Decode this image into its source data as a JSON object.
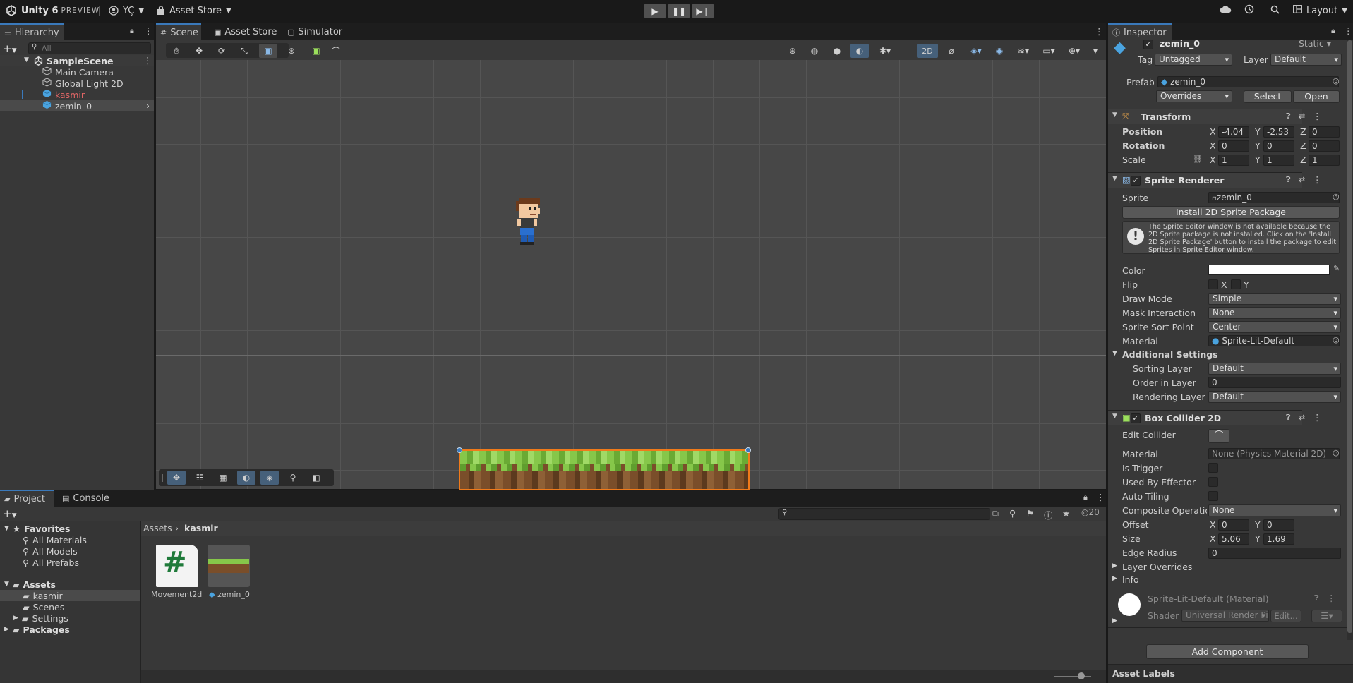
{
  "toolbar": {
    "app_title": "Unity 6",
    "app_edition": "PREVIEW",
    "account": "YÇ",
    "asset_store": "Asset Store",
    "layout": "Layout"
  },
  "hierarchy": {
    "tab": "Hierarchy",
    "search_placeholder": "All",
    "scene": "SampleScene",
    "items": [
      {
        "label": "Main Camera"
      },
      {
        "label": "Global Light 2D"
      },
      {
        "label": "kasmir"
      },
      {
        "label": "zemin_0"
      }
    ]
  },
  "scene_tabs": [
    {
      "label": "Scene"
    },
    {
      "label": "Asset Store"
    },
    {
      "label": "Simulator"
    }
  ],
  "scene_toolbar": {
    "mode_2d": "2D"
  },
  "project": {
    "tabs": [
      {
        "label": "Project"
      },
      {
        "label": "Console"
      }
    ],
    "favorites": {
      "label": "Favorites",
      "items": [
        "All Materials",
        "All Models",
        "All Prefabs"
      ]
    },
    "assets": {
      "label": "Assets",
      "items": [
        "kasmir",
        "Scenes",
        "Settings"
      ]
    },
    "packages": "Packages",
    "breadcrumb": [
      "Assets",
      "kasmir"
    ],
    "item_count": "20",
    "files": [
      {
        "label": "Movement2d"
      },
      {
        "label": "zemin_0"
      }
    ]
  },
  "inspector": {
    "tab": "Inspector",
    "object_name": "zemin_0",
    "static_label": "Static",
    "tag_label": "Tag",
    "tag_value": "Untagged",
    "layer_label": "Layer",
    "layer_value": "Default",
    "prefab_label": "Prefab",
    "prefab_value": "zemin_0",
    "overrides": "Overrides",
    "select": "Select",
    "open": "Open",
    "transform": {
      "title": "Transform",
      "position": {
        "label": "Position",
        "x": "-4.04",
        "y": "-2.53",
        "z": "0"
      },
      "rotation": {
        "label": "Rotation",
        "x": "0",
        "y": "0",
        "z": "0"
      },
      "scale": {
        "label": "Scale",
        "x": "1",
        "y": "1",
        "z": "1"
      }
    },
    "sprite_renderer": {
      "title": "Sprite Renderer",
      "sprite_label": "Sprite",
      "sprite_value": "zemin_0",
      "install_button": "Install 2D Sprite Package",
      "warning": "The Sprite Editor window is not available because the 2D Sprite package is not installed. Click on the 'Install 2D Sprite Package' button to install the package to edit Sprites in Sprite Editor window.",
      "color_label": "Color",
      "flip_label": "Flip",
      "flip_x": "X",
      "flip_y": "Y",
      "draw_mode_label": "Draw Mode",
      "draw_mode_value": "Simple",
      "mask_label": "Mask Interaction",
      "mask_value": "None",
      "sort_point_label": "Sprite Sort Point",
      "sort_point_value": "Center",
      "material_label": "Material",
      "material_value": "Sprite-Lit-Default",
      "additional": "Additional Settings",
      "sorting_layer_label": "Sorting Layer",
      "sorting_layer_value": "Default",
      "order_label": "Order in Layer",
      "order_value": "0",
      "rendering_layer_label": "Rendering Layer M",
      "rendering_layer_value": "Default"
    },
    "box_collider": {
      "title": "Box Collider 2D",
      "edit_collider": "Edit Collider",
      "material_label": "Material",
      "material_value": "None (Physics Material 2D)",
      "is_trigger": "Is Trigger",
      "used_by_effector": "Used By Effector",
      "auto_tiling": "Auto Tiling",
      "composite_label": "Composite Operation",
      "composite_value": "None",
      "offset_label": "Offset",
      "offset_x": "0",
      "offset_y": "0",
      "size_label": "Size",
      "size_x": "5.06",
      "size_y": "1.69",
      "edge_radius_label": "Edge Radius",
      "edge_radius_value": "0",
      "layer_overrides": "Layer Overrides",
      "info": "Info"
    },
    "material_preview": {
      "name": "Sprite-Lit-Default (Material)",
      "shader_label": "Shader",
      "shader_value": "Universal Render Pi",
      "edit": "Edit..."
    },
    "add_component": "Add Component",
    "asset_labels": "Asset Labels"
  },
  "colors": {
    "accent": "#3a79bb",
    "selection": "#2c5d87",
    "missing_red": "#e06666",
    "bounds_orange": "#f07a1a"
  }
}
